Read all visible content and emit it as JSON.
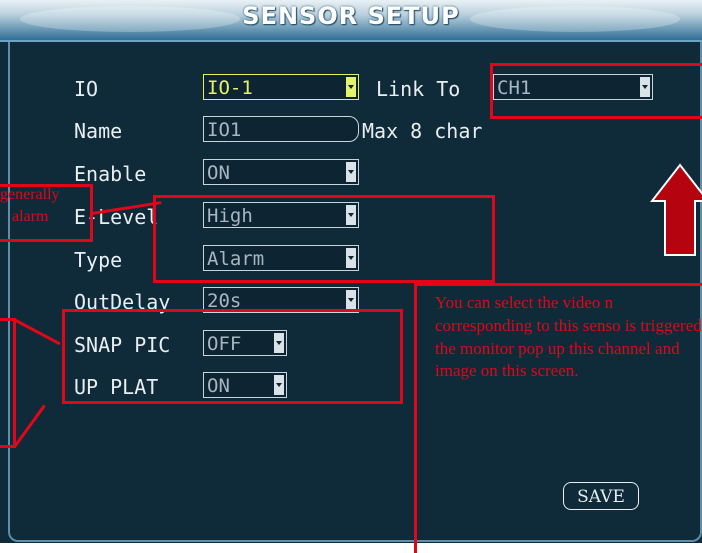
{
  "title": "SENSOR SETUP",
  "labels": {
    "io": "IO",
    "link_to": "Link To",
    "name": "Name",
    "max_hint": "Max 8 char",
    "enable": "Enable",
    "e_level": "E-Level",
    "type": "Type",
    "out_delay": "OutDelay",
    "snap_pic": "SNAP PIC",
    "up_plat": "UP PLAT"
  },
  "fields": {
    "io": "IO-1",
    "link_to": "CH1",
    "name": "IO1",
    "enable": "ON",
    "e_level": "High",
    "type": "Alarm",
    "out_delay": "20s",
    "snap_pic": "OFF",
    "up_plat": "ON"
  },
  "save_label": "SAVE",
  "annotations": {
    "left_note_line1": "generally",
    "left_note_line2": "alarm",
    "right_note": "You can select the video n corresponding to this senso is triggered, the monitor pop up this channel and image on this screen."
  },
  "colors": {
    "background": "#0f2a38",
    "active_field": "#e6f26a",
    "annotation": "#e0071a",
    "arrow": "#b5040f"
  }
}
